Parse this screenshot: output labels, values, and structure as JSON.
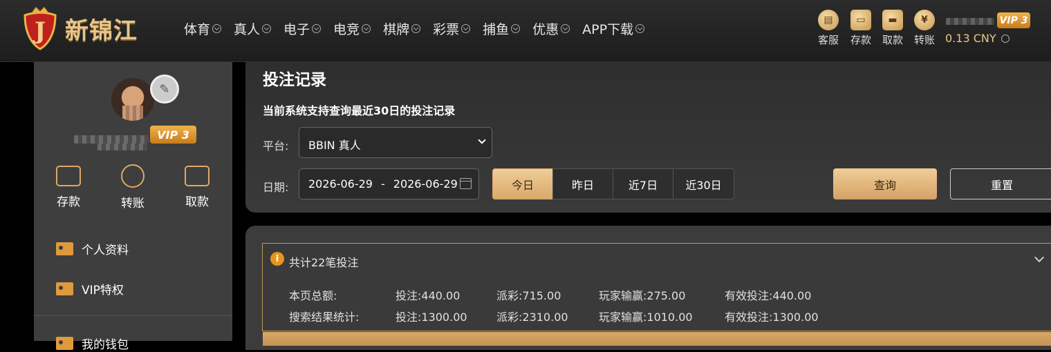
{
  "brand": {
    "name": "新锦江",
    "badge_letter": "J"
  },
  "nav": [
    {
      "label": "体育"
    },
    {
      "label": "真人"
    },
    {
      "label": "电子"
    },
    {
      "label": "电竞"
    },
    {
      "label": "棋牌"
    },
    {
      "label": "彩票"
    },
    {
      "label": "捕鱼"
    },
    {
      "label": "优惠"
    },
    {
      "label": "APP下载"
    }
  ],
  "toolbar": {
    "service": "客服",
    "deposit": "存款",
    "withdraw": "取款",
    "transfer": "转账",
    "vip": "VIP 3",
    "balance": "0.13 CNY"
  },
  "sidebar": {
    "vip": "VIP 3",
    "actions": {
      "deposit": "存款",
      "transfer": "转账",
      "withdraw": "取款"
    },
    "menu": [
      {
        "label": "个人资料"
      },
      {
        "label": "VIP特权"
      },
      {
        "label": "我的钱包"
      }
    ]
  },
  "filter": {
    "title": "投注记录",
    "subtitle": "当前系统支持查询最近30日的投注记录",
    "platform_label": "平台:",
    "platform_value": "BBIN 真人",
    "date_label": "日期:",
    "date_start": "2026-06-29",
    "date_sep": "-",
    "date_end": "2026-06-29",
    "ranges": [
      {
        "label": "今日",
        "active": true
      },
      {
        "label": "昨日"
      },
      {
        "label": "近7日"
      },
      {
        "label": "近30日"
      }
    ],
    "query": "查询",
    "reset": "重置"
  },
  "summary": {
    "title": "共计22笔投注",
    "rows": [
      {
        "label": "本页总额:",
        "bet": "投注:440.00",
        "payout": "派彩:715.00",
        "winloss": "玩家输赢:275.00",
        "valid": "有效投注:440.00"
      },
      {
        "label": "搜索结果统计:",
        "bet": "投注:1300.00",
        "payout": "派彩:2310.00",
        "winloss": "玩家输赢:1010.00",
        "valid": "有效投注:1300.00"
      }
    ]
  }
}
